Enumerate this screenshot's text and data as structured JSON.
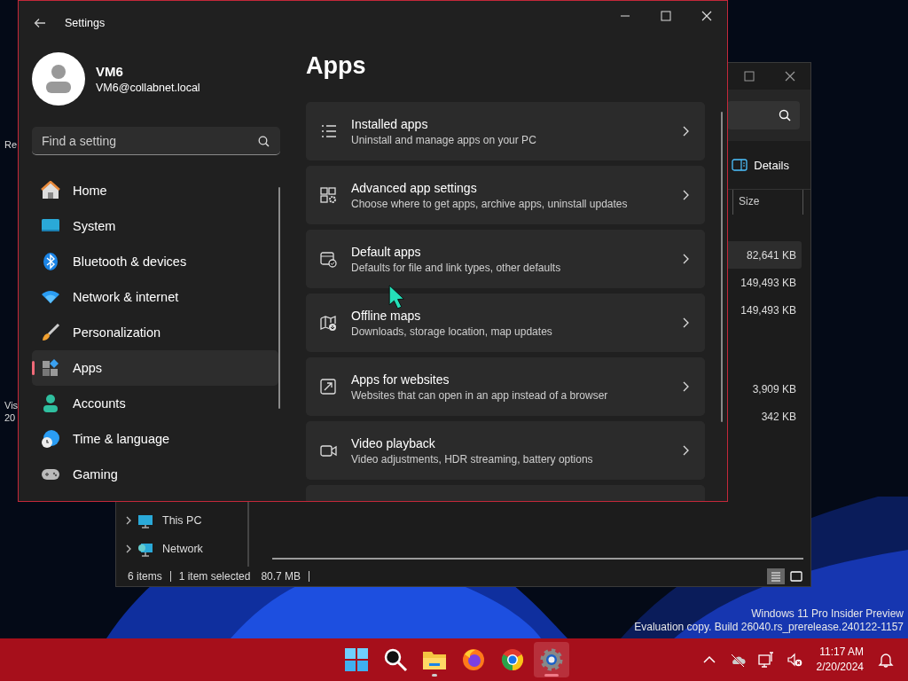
{
  "desktop": {
    "icon_labels": [
      "Re",
      "Vis",
      "20"
    ]
  },
  "explorer": {
    "details_button": "Details",
    "column_header": "Size",
    "file_groups": [
      {
        "sizes": [
          {
            "text": "82,641 KB",
            "selected": true
          },
          {
            "text": "149,493 KB",
            "selected": false
          },
          {
            "text": "149,493 KB",
            "selected": false
          }
        ]
      },
      {
        "sizes": [
          {
            "text": "3,909 KB",
            "selected": false
          },
          {
            "text": "342 KB",
            "selected": false
          }
        ]
      }
    ],
    "nav_items": [
      {
        "label": "This PC",
        "kind": "pc"
      },
      {
        "label": "Network",
        "kind": "network"
      }
    ],
    "status": {
      "items": "6 items",
      "selection": "1 item selected",
      "selection_size": "80.7 MB"
    },
    "views": [
      {
        "kind": "details",
        "selected": true
      },
      {
        "kind": "tiles",
        "selected": false
      }
    ]
  },
  "settings": {
    "title": "Settings",
    "user": {
      "name": "VM6",
      "email": "VM6@collabnet.local"
    },
    "search": {
      "placeholder": "Find a setting"
    },
    "nav": [
      {
        "label": "Home",
        "kind": "home",
        "selected": false
      },
      {
        "label": "System",
        "kind": "system",
        "selected": false
      },
      {
        "label": "Bluetooth & devices",
        "kind": "bluetooth",
        "selected": false
      },
      {
        "label": "Network & internet",
        "kind": "network",
        "selected": false
      },
      {
        "label": "Personalization",
        "kind": "brush",
        "selected": false
      },
      {
        "label": "Apps",
        "kind": "apps",
        "selected": true
      },
      {
        "label": "Accounts",
        "kind": "accounts",
        "selected": false
      },
      {
        "label": "Time & language",
        "kind": "time",
        "selected": false
      },
      {
        "label": "Gaming",
        "kind": "gaming",
        "selected": false
      }
    ],
    "heading": "Apps",
    "cards": [
      {
        "kind": "list",
        "title": "Installed apps",
        "subtitle": "Uninstall and manage apps on your PC"
      },
      {
        "kind": "advanced",
        "title": "Advanced app settings",
        "subtitle": "Choose where to get apps, archive apps, uninstall updates"
      },
      {
        "kind": "default",
        "title": "Default apps",
        "subtitle": "Defaults for file and link types, other defaults"
      },
      {
        "kind": "map",
        "title": "Offline maps",
        "subtitle": "Downloads, storage location, map updates"
      },
      {
        "kind": "websites",
        "title": "Apps for websites",
        "subtitle": "Websites that can open in an app instead of a browser"
      },
      {
        "kind": "video",
        "title": "Video playback",
        "subtitle": "Video adjustments, HDR streaming, battery options"
      }
    ]
  },
  "watermark": [
    "Windows 11 Pro Insider Preview",
    "Evaluation copy. Build 26040.rs_prerelease.240122-1157"
  ],
  "taskbar": {
    "apps": [
      {
        "kind": "start",
        "running": false,
        "selected": false
      },
      {
        "kind": "search",
        "running": false,
        "selected": false
      },
      {
        "kind": "explorer",
        "running": true,
        "selected": false
      },
      {
        "kind": "firefox",
        "running": false,
        "selected": false
      },
      {
        "kind": "chrome",
        "running": false,
        "selected": false
      },
      {
        "kind": "settings",
        "running": true,
        "selected": true
      }
    ],
    "time": "11:17 AM",
    "date": "2/20/2024"
  }
}
